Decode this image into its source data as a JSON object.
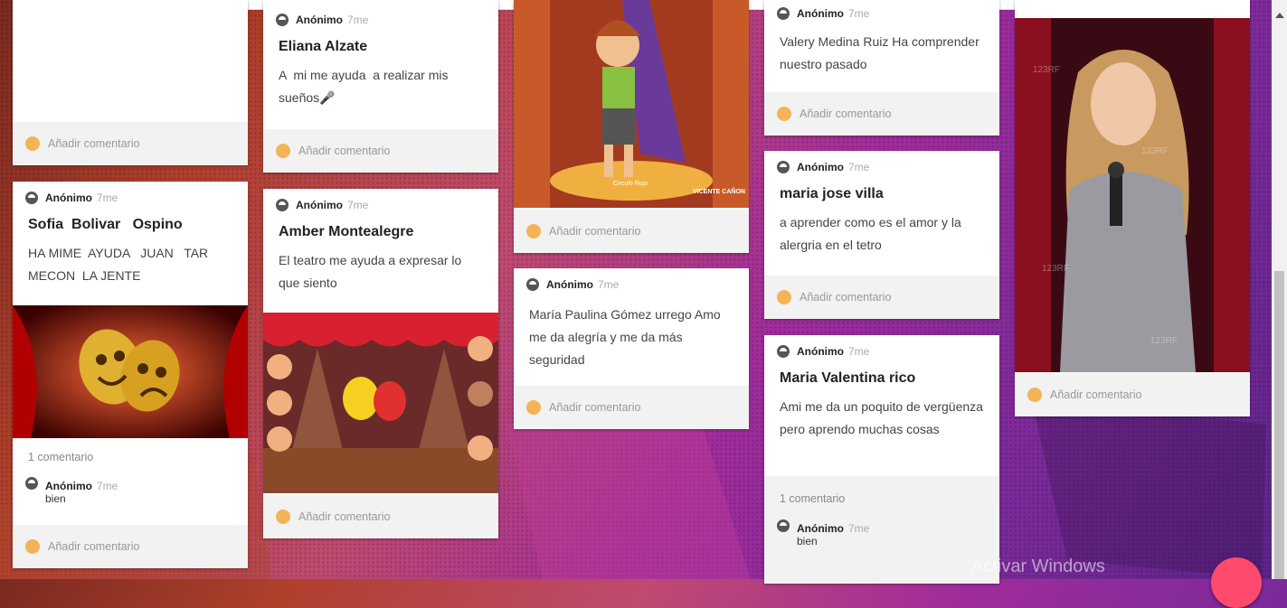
{
  "comment_add_label": "Añadir comentario",
  "cards": {
    "c1a": {
      "footer": "Añadir comentario"
    },
    "c1b": {
      "author": "Anónimo",
      "time": "7me",
      "title": "Sofia  Bolivar   Ospino",
      "body": "HA MIME  AYUDA   JUAN   TAR MECON  LA JENTE",
      "comment_count": "1 comentario",
      "comment": {
        "author": "Anónimo",
        "time": "7me",
        "text": "bien"
      },
      "footer": "Añadir comentario"
    },
    "c2a": {
      "author": "Anónimo",
      "time": "7me",
      "title": "Eliana Alzate",
      "body": "A  mi me ayuda  a realizar mis sueños🎤",
      "footer": "Añadir comentario"
    },
    "c2b": {
      "author": "Anónimo",
      "time": "7me",
      "title": "Amber Montealegre",
      "body": "El teatro me ayuda a expresar lo que siento",
      "footer": "Añadir comentario"
    },
    "c3a": {
      "footer": "Añadir comentario",
      "image_caption": "Circulo Rojo",
      "image_signature": "VICENTE CAÑON"
    },
    "c3b": {
      "author": "Anónimo",
      "time": "7me",
      "body": "María Paulina Gómez urrego Amo me da alegría y me da más seguridad",
      "footer": "Añadir comentario"
    },
    "c4a": {
      "author": "Anónimo",
      "time": "7me",
      "body": "Valery Medina Ruiz Ha comprender nuestro pasado",
      "footer": "Añadir comentario"
    },
    "c4b": {
      "author": "Anónimo",
      "time": "7me",
      "title": "maria jose villa",
      "body": "a aprender como es el amor y la alergria en el tetro",
      "footer": "Añadir comentario"
    },
    "c4c": {
      "author": "Anónimo",
      "time": "7me",
      "title": "Maria Valentina rico",
      "body": "Ami me da un poquito de vergüenza pero aprendo muchas cosas",
      "comment_count": "1 comentario",
      "comment": {
        "author": "Anónimo",
        "time": "7me",
        "text": "bien"
      }
    },
    "c5a": {
      "footer": "Añadir comentario",
      "image_watermark": "123RF"
    }
  },
  "windows_watermark": "Activar Windows",
  "colors": {
    "accent_dot": "#f2b456",
    "fab": "#ff4a6e"
  }
}
